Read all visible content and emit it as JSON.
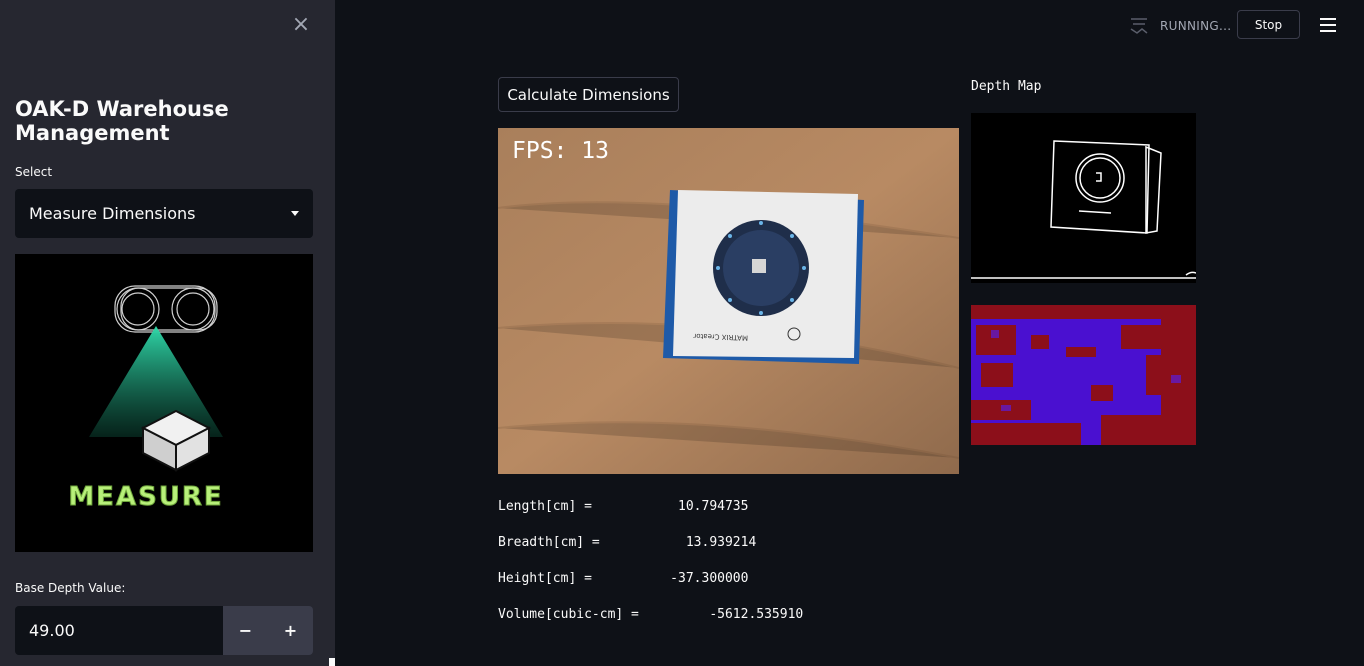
{
  "sidebar": {
    "close_label": "×",
    "title": "OAK-D Warehouse Management",
    "select_label": "Select",
    "select_value": "Measure Dimensions",
    "logo_text": "MEASURE",
    "base_depth_label": "Base Depth Value:",
    "base_depth_value": "49.00",
    "minus_label": "−",
    "plus_label": "+"
  },
  "header": {
    "status": "RUNNING...",
    "stop_label": "Stop"
  },
  "main": {
    "calculate_label": "Calculate Dimensions",
    "fps_text": "FPS: 13",
    "box_label": "MATRIX Creator",
    "depth_map_title": "Depth Map",
    "measurements": [
      {
        "text": "Length[cm] =           10.794735"
      },
      {
        "text": "Breadth[cm] =           13.939214"
      },
      {
        "text": "Height[cm] =          -37.300000"
      },
      {
        "text": "Volume[cubic-cm] =         -5612.535910"
      }
    ]
  },
  "colors": {
    "background": "#0e1117",
    "sidebar": "#262730",
    "accent_teal": "#2fd7a8",
    "logo_text": "#b8f07a"
  }
}
